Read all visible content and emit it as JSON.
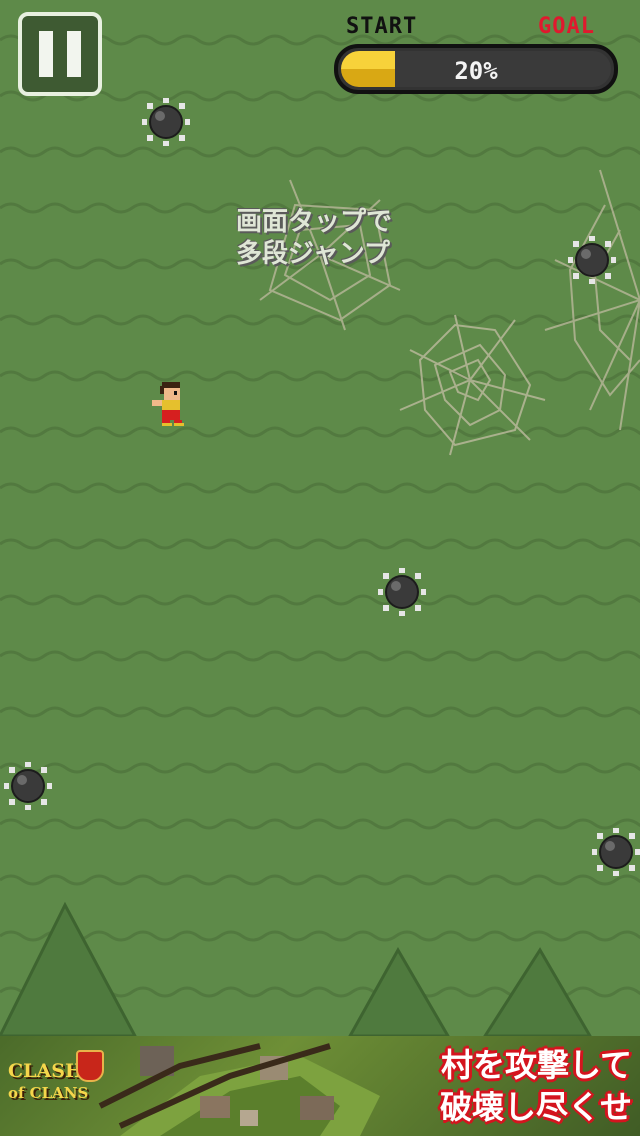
{
  "hud": {
    "pause_label": "Pause",
    "start_label": "START",
    "goal_label": "GOAL",
    "progress_fraction": 0.2,
    "progress_text": "20%"
  },
  "hint": {
    "line1": "画面タップで",
    "line2": "多段ジャンプ"
  },
  "colors": {
    "background": "#5e8a49",
    "wave": "#52793f",
    "goal_text": "#e0192e",
    "progress_fill": "#f2c62c"
  },
  "mines": [
    {
      "name": "spike-mine-1"
    },
    {
      "name": "spike-mine-2"
    },
    {
      "name": "spike-mine-3"
    },
    {
      "name": "spike-mine-4"
    },
    {
      "name": "spike-mine-5"
    }
  ],
  "ad": {
    "logo_line1": "CLASH",
    "logo_line2": "of CLANS",
    "tagline1": "村を攻撃して",
    "tagline2": "破壊し尽くせ"
  }
}
